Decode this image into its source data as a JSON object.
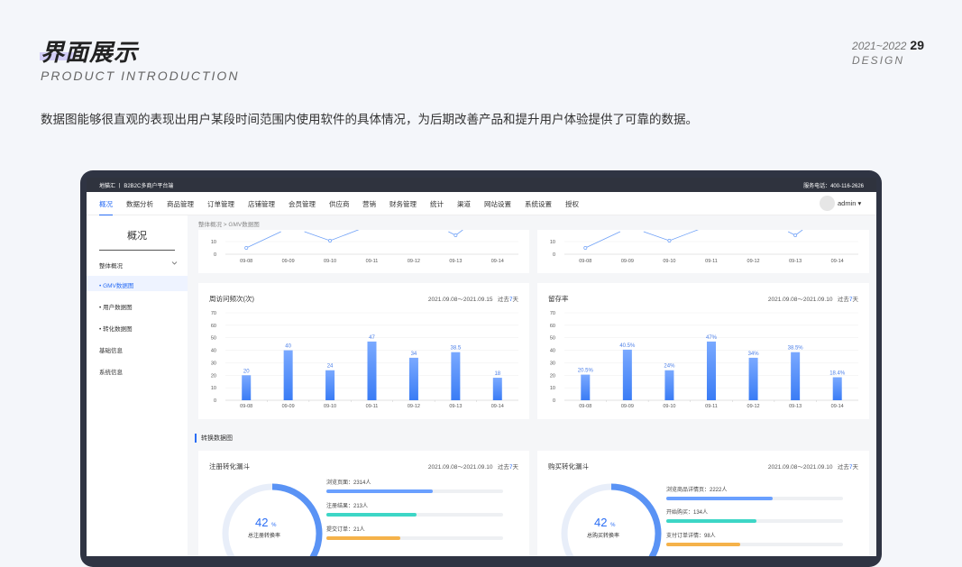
{
  "slide": {
    "title_cn": "界面展示",
    "title_en": "PRODUCT INTRODUCTION",
    "years": "2021~2022",
    "page_num": "29",
    "design": "DESIGN",
    "description": "数据图能够很直观的表现出用户某段时间范围内使用软件的具体情况，为后期改善产品和提升用户体验提供了可靠的数据。"
  },
  "app": {
    "brand": "地猫汇 丨 B2B2C多商户平台端",
    "service": "服务电话：400-116-2626",
    "nav": [
      "概况",
      "数据分析",
      "商品管理",
      "订单管理",
      "店铺管理",
      "会员管理",
      "供应商",
      "营销",
      "财务管理",
      "统计",
      "渠道",
      "网站设置",
      "系统设置",
      "授权"
    ],
    "user": "admin ▾",
    "sidebar": {
      "title": "概况",
      "group": "整体概况",
      "items": [
        "• GMV数据图",
        "• 用户数据图",
        "• 转化数据图"
      ],
      "extra": [
        "基础信息",
        "系统信息"
      ]
    },
    "breadcrumb": "整体概况  >  GMV数据图",
    "section_title": "转换数据图",
    "colors": {
      "accent": "#2a6df4",
      "bar_top": "#7aa9ff",
      "bar_bottom": "#3a7cf5",
      "teal": "#3dd6c6"
    }
  },
  "top_charts": {
    "ticks": [
      "10",
      "0"
    ],
    "categories": [
      "09-08",
      "09-09",
      "09-10",
      "09-11",
      "09-12",
      "09-13",
      "09-14"
    ]
  },
  "chart_data": [
    {
      "type": "bar",
      "title": "周访问频次(次)",
      "date_range": "2021.09.08～2021.09.15",
      "period_prefix": "过去",
      "period_num": "7",
      "period_suffix": "天",
      "categories": [
        "09-08",
        "09-09",
        "09-10",
        "09-11",
        "09-12",
        "09-13",
        "09-14"
      ],
      "values": [
        20,
        40,
        24,
        47,
        34,
        38.5,
        18
      ],
      "labels": [
        "20",
        "40",
        "24",
        "47",
        "34",
        "38.5",
        "18"
      ],
      "yticks": [
        "70",
        "60",
        "50",
        "40",
        "30",
        "20",
        "10",
        "0"
      ],
      "ylim": [
        0,
        70
      ]
    },
    {
      "type": "bar",
      "title": "留存率",
      "date_range": "2021.09.08～2021.09.10",
      "period_prefix": "过去",
      "period_num": "7",
      "period_suffix": "天",
      "categories": [
        "09-08",
        "09-09",
        "09-10",
        "09-11",
        "09-12",
        "09-13",
        "09-14"
      ],
      "values": [
        20.5,
        40.5,
        24,
        47,
        34,
        38.5,
        18.4
      ],
      "labels": [
        "20.5%",
        "40.5%",
        "24%",
        "47%",
        "34%",
        "38.5%",
        "18.4%"
      ],
      "yticks": [
        "70",
        "60",
        "50",
        "40",
        "30",
        "20",
        "10",
        "0"
      ],
      "ylim": [
        0,
        70
      ]
    }
  ],
  "funnels": [
    {
      "title": "注册转化漏斗",
      "date_range": "2021.09.08～2021.09.10",
      "period_prefix": "过去",
      "period_num": "7",
      "period_suffix": "天",
      "center_value": "42",
      "center_unit": "%",
      "center_label": "总注册转换率",
      "ring_fraction": 0.42,
      "rows": [
        {
          "label": "浏览页面：2314人",
          "fraction": 0.6,
          "color": "#6aa0ff"
        },
        {
          "label": "注册结果：213人",
          "fraction": 0.51,
          "color": "#3dd6c6"
        },
        {
          "label": "提交订单：21人",
          "fraction": 0.42,
          "color": "#f5b24a"
        }
      ]
    },
    {
      "title": "购买转化漏斗",
      "date_range": "2021.09.08～2021.09.10",
      "period_prefix": "过去",
      "period_num": "7",
      "period_suffix": "天",
      "center_value": "42",
      "center_unit": "%",
      "center_label": "总购买转换率",
      "ring_fraction": 0.42,
      "rows": [
        {
          "label": "浏览商品详情页：2222人",
          "fraction": 0.6,
          "color": "#6aa0ff"
        },
        {
          "label": "开始购买：134人",
          "fraction": 0.51,
          "color": "#3dd6c6"
        },
        {
          "label": "支付订单详情：98人",
          "fraction": 0.42,
          "color": "#f5b24a"
        }
      ]
    }
  ]
}
